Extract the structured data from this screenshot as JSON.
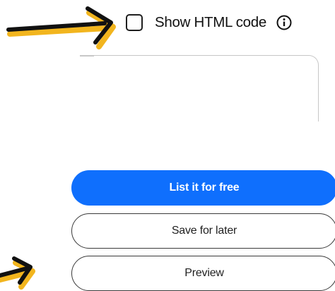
{
  "html_toggle": {
    "label": "Show HTML code",
    "checked": false,
    "icon": "info-icon"
  },
  "actions": {
    "list_label": "List it for free",
    "save_label": "Save for later",
    "preview_label": "Preview"
  },
  "colors": {
    "primary": "#0f6ffd",
    "arrow": "#111111",
    "arrow_highlight": "#f2b51e"
  }
}
